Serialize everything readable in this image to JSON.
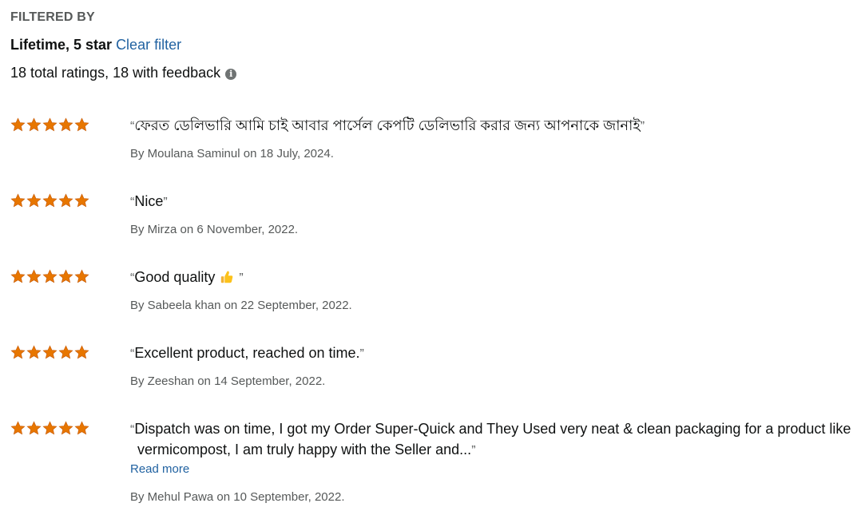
{
  "header": {
    "filtered_by": "FILTERED BY",
    "filter_value": "Lifetime, 5 star",
    "clear_filter": "Clear filter",
    "summary": "18 total ratings, 18 with feedback",
    "info_icon": "info-icon"
  },
  "colors": {
    "star": "#e77600",
    "link": "#2162a1",
    "muted": "#565959"
  },
  "reviews": [
    {
      "rating": 5,
      "text": "ফেরত ডেলিভারি আমি চাই আবার পার্সেল কেপটি ডেলিভারি করার জন্য আপনাকে জানাই",
      "byline": "By Moulana Saminul on 18 July, 2024."
    },
    {
      "rating": 5,
      "text": "Nice",
      "byline": "By Mirza on 6 November, 2022."
    },
    {
      "rating": 5,
      "text": "Good quality",
      "emoji": "thumbs-up-icon",
      "byline": "By Sabeela khan on 22 September, 2022."
    },
    {
      "rating": 5,
      "text": "Excellent product, reached on time.",
      "byline": "By Zeeshan on 14 September, 2022."
    },
    {
      "rating": 5,
      "text": "Dispatch was on time, I got my Order Super-Quick and They Used very neat & clean packaging for a product like vermicompost, I am truly happy with the Seller and...",
      "read_more": "Read more",
      "byline": "By Mehul Pawa on 10 September, 2022."
    }
  ]
}
